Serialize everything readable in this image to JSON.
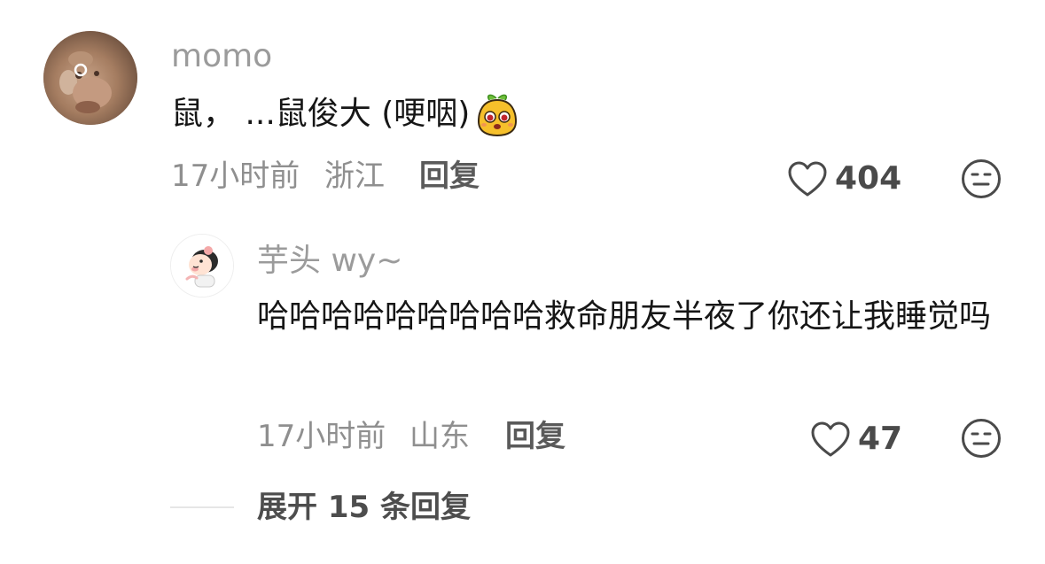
{
  "comment": {
    "username": "momo",
    "text": "鼠， ...鼠俊大 (哽咽)",
    "emoji_icon": "mango-emoji-icon",
    "time": "17小时前",
    "location": "浙江",
    "reply_label": "回复",
    "likes": "404"
  },
  "reply": {
    "username": "芋头 wy~",
    "text": "哈哈哈哈哈哈哈哈哈救命朋友半夜了你还让我睡觉吗",
    "time": "17小时前",
    "location": "山东",
    "reply_label": "回复",
    "likes": "47"
  },
  "expand": {
    "label": "展开 15 条回复"
  },
  "colors": {
    "text": "#161616",
    "meta": "#8f8f8f",
    "username": "#9b9b9b",
    "icon_stroke": "#4a4a4a"
  },
  "icons": [
    "heart-icon",
    "meh-face-icon",
    "monkey-avatar",
    "cartoon-kid-avatar"
  ]
}
